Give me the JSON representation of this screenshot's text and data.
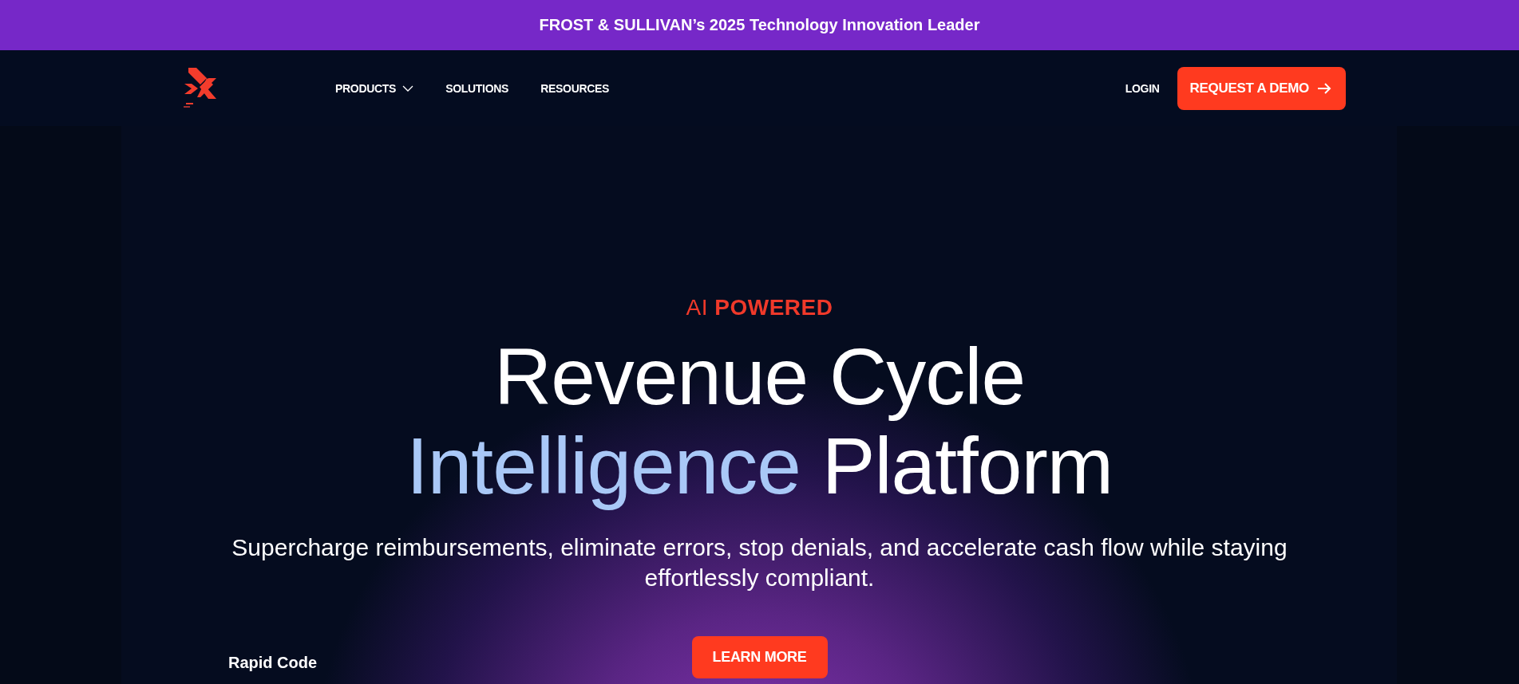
{
  "announcement": {
    "text": "FROST & SULLIVAN’s 2025 Technology Innovation Leader"
  },
  "nav": {
    "links": [
      {
        "label": "PRODUCTS",
        "kind": "dropdown"
      },
      {
        "label": "SOLUTIONS",
        "kind": "link"
      },
      {
        "label": "RESOURCES",
        "kind": "link"
      }
    ],
    "login": "LOGIN",
    "cta": "REQUEST A DEMO"
  },
  "hero": {
    "eyebrow": "AI **POWERED**",
    "title_line_1": "Revenue Cycle",
    "title_highlight": "Intelligence",
    "title_rest": "Platform",
    "subtitle": "Supercharge reimbursements, eliminate errors, stop denials, and accelerate cash flow while staying effortlessly compliant.",
    "button": "LEARN MORE",
    "footer_label": "Rapid Code"
  }
}
